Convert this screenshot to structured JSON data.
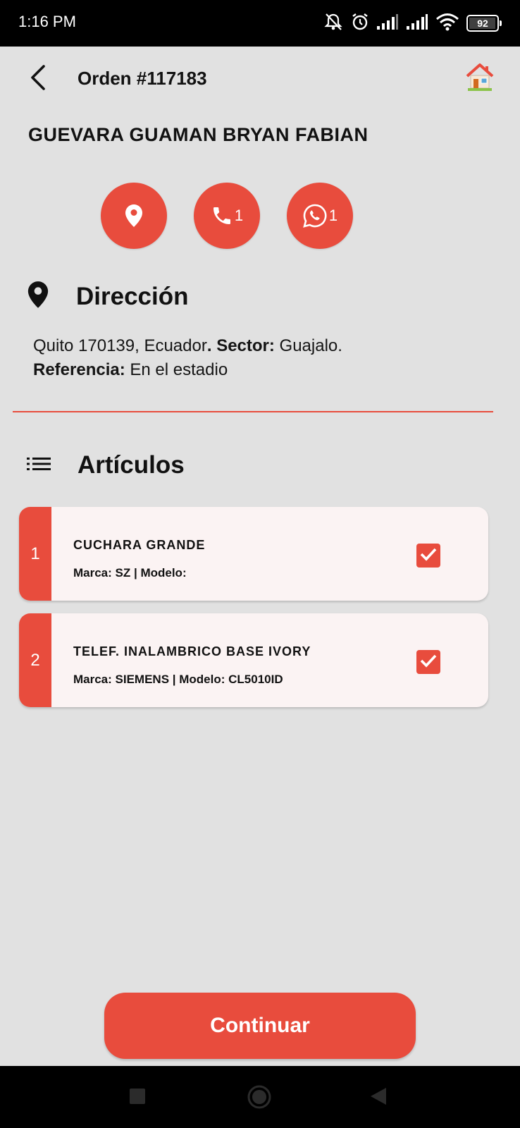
{
  "status_bar": {
    "time": "1:16 PM",
    "battery_level": "92",
    "icons": [
      "silent-bell-icon",
      "alarm-icon",
      "signal-icon",
      "signal-icon",
      "wifi-icon",
      "battery-icon"
    ]
  },
  "header": {
    "title": "Orden #117183",
    "back_icon": "back-arrow-icon",
    "home_icon": "home-icon"
  },
  "customer": {
    "name": "GUEVARA GUAMAN BRYAN FABIAN"
  },
  "actions": {
    "location_icon": "location-pin-icon",
    "phone_count": "1",
    "whatsapp_count": "1"
  },
  "address_section": {
    "title": "Dirección",
    "address": "Quito 170139, Ecuador",
    "sep": ". ",
    "sector_label": "Sector:",
    "sector_value": " Guajalo.",
    "reference_label": "Referencia:",
    "reference_value": " En el estadio"
  },
  "articles_section": {
    "title": "Artículos",
    "items": [
      {
        "number": "1",
        "name": "CUCHARA GRANDE",
        "meta": "Marca: SZ | Modelo:",
        "checked": true
      },
      {
        "number": "2",
        "name": "TELEF. INALAMBRICO BASE IVORY",
        "meta": "Marca: SIEMENS | Modelo: CL5010ID",
        "checked": true
      }
    ]
  },
  "footer": {
    "continue_label": "Continuar"
  },
  "colors": {
    "accent": "#e84c3d",
    "background": "#e1e1e1",
    "card": "#fbf3f3"
  }
}
